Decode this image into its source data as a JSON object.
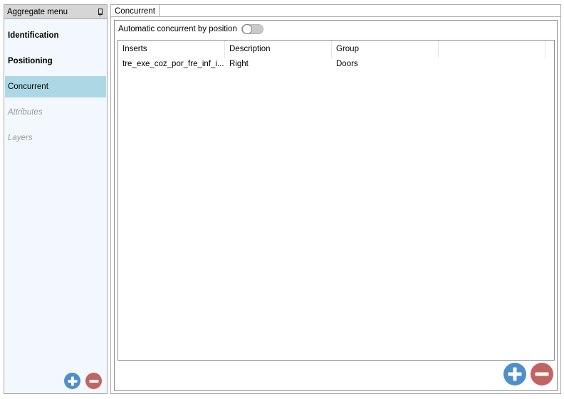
{
  "left_panel": {
    "title": "Aggregate menu",
    "pin_icon": "pin-icon",
    "items": [
      {
        "label": "Identification",
        "style": "bold"
      },
      {
        "label": "Positioning",
        "style": "bold"
      },
      {
        "label": "Concurrent",
        "style": "selected"
      },
      {
        "label": "Attributes",
        "style": "disabled"
      },
      {
        "label": "Layers",
        "style": "disabled"
      }
    ],
    "add_icon": "plus-circle-icon",
    "remove_icon": "minus-circle-icon"
  },
  "tab": {
    "label": "Concurrent"
  },
  "auto_concurrent": {
    "label": "Automatic concurrent by position",
    "enabled": false
  },
  "grid": {
    "columns": [
      "Inserts",
      "Description",
      "Group"
    ],
    "rows": [
      [
        "tre_exe_coz_por_fre_inf_i...",
        "Right",
        "Doors"
      ]
    ]
  },
  "colors": {
    "accent_blue": "#4f8fc9",
    "accent_red": "#c16363",
    "selected_item": "#acd8e6",
    "panel_bg": "#f2f8fd"
  }
}
